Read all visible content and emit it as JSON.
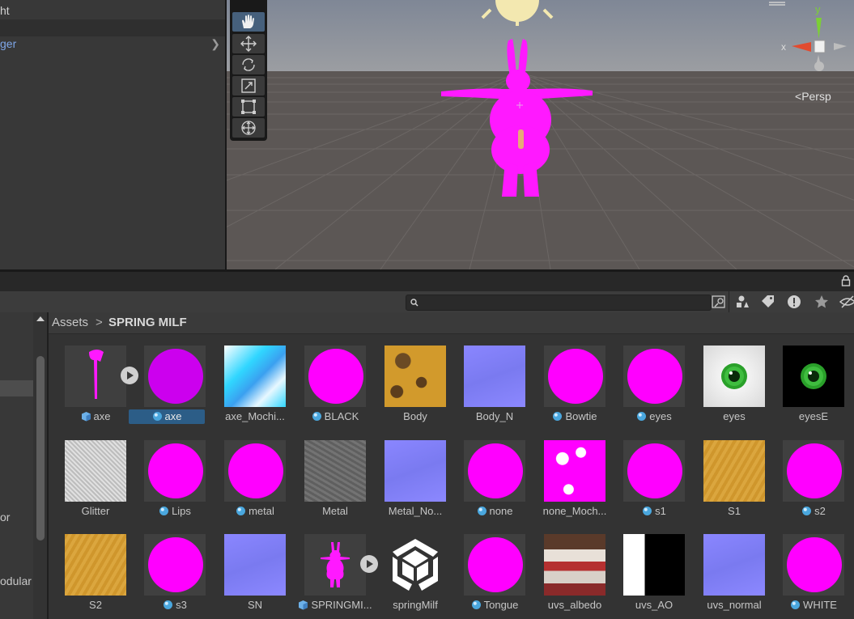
{
  "hierarchy": {
    "row1": "ht",
    "row2": "",
    "row3": "ger"
  },
  "scene": {
    "projection_label": "Persp",
    "gizmo_axes": {
      "y": "y",
      "x": "x"
    },
    "colors": {
      "sky": "#8a8f98",
      "ground": "#5d5856",
      "model": "#ff19ff"
    }
  },
  "tools": [
    {
      "name": "hand-tool",
      "active": true
    },
    {
      "name": "move-tool",
      "active": false
    },
    {
      "name": "rotate-tool",
      "active": false
    },
    {
      "name": "scale-tool",
      "active": false
    },
    {
      "name": "rect-tool",
      "active": false
    },
    {
      "name": "transform-tool",
      "active": false
    }
  ],
  "project": {
    "search": {
      "value": "",
      "placeholder": ""
    },
    "breadcrumb": {
      "root": "Assets",
      "separator": ">",
      "current": "SPRING MILF"
    },
    "folders": [
      "or",
      "odular"
    ],
    "assets": [
      {
        "label": "axe",
        "kind": "model",
        "badge": "prefab-icon",
        "color": "#ff19ff"
      },
      {
        "label": "axe",
        "kind": "material",
        "badge": "material-icon",
        "color": "#cc00ee",
        "selected": true
      },
      {
        "label": "axe_Mochi...",
        "kind": "texture",
        "color": "#38d8f4"
      },
      {
        "label": "BLACK",
        "kind": "material",
        "badge": "material-icon",
        "color": "#ff00ff"
      },
      {
        "label": "Body",
        "kind": "texture",
        "color": "#d29a2c"
      },
      {
        "label": "Body_N",
        "kind": "texture",
        "color": "#8080f0"
      },
      {
        "label": "Bowtie",
        "kind": "material",
        "badge": "material-icon",
        "color": "#ff00ff"
      },
      {
        "label": "eyes",
        "kind": "material",
        "badge": "material-icon",
        "color": "#ff00ff"
      },
      {
        "label": "eyes",
        "kind": "texture-eye",
        "color": "#f2f2f2"
      },
      {
        "label": "eyesE",
        "kind": "texture-eye",
        "color": "#000000"
      },
      {
        "label": "Glitter",
        "kind": "texture",
        "color": "#c8c8c8"
      },
      {
        "label": "Lips",
        "kind": "material",
        "badge": "material-icon",
        "color": "#ff00ff"
      },
      {
        "label": "metal",
        "kind": "material",
        "badge": "material-icon",
        "color": "#ff00ff"
      },
      {
        "label": "Metal",
        "kind": "texture",
        "color": "#6b6b6b"
      },
      {
        "label": "Metal_No...",
        "kind": "texture",
        "color": "#7f7ff8"
      },
      {
        "label": "none",
        "kind": "material",
        "badge": "material-icon",
        "color": "#ff00ff"
      },
      {
        "label": "none_Moch...",
        "kind": "texture",
        "color": "#ff00ff"
      },
      {
        "label": "s1",
        "kind": "material",
        "badge": "material-icon",
        "color": "#ff00ff"
      },
      {
        "label": "S1",
        "kind": "texture",
        "color": "#d29a2c"
      },
      {
        "label": "s2",
        "kind": "material",
        "badge": "material-icon",
        "color": "#ff00ff"
      },
      {
        "label": "S2",
        "kind": "texture",
        "color": "#d2a040"
      },
      {
        "label": "s3",
        "kind": "material",
        "badge": "material-icon",
        "color": "#ff00ff"
      },
      {
        "label": "SN",
        "kind": "texture",
        "color": "#7f7ff8"
      },
      {
        "label": "SPRINGMI...",
        "kind": "model",
        "badge": "prefab-icon",
        "color": "#ff19ff"
      },
      {
        "label": "springMilf",
        "kind": "unity",
        "color": "#ffffff"
      },
      {
        "label": "Tongue",
        "kind": "material",
        "badge": "material-icon",
        "color": "#ff00ff"
      },
      {
        "label": "uvs_albedo",
        "kind": "texture",
        "color": "#b53030"
      },
      {
        "label": "uvs_AO",
        "kind": "texture",
        "color": "#000000"
      },
      {
        "label": "uvs_normal",
        "kind": "texture",
        "color": "#7f7ff8"
      },
      {
        "label": "WHITE",
        "kind": "material",
        "badge": "material-icon",
        "color": "#ff00ff"
      }
    ]
  }
}
